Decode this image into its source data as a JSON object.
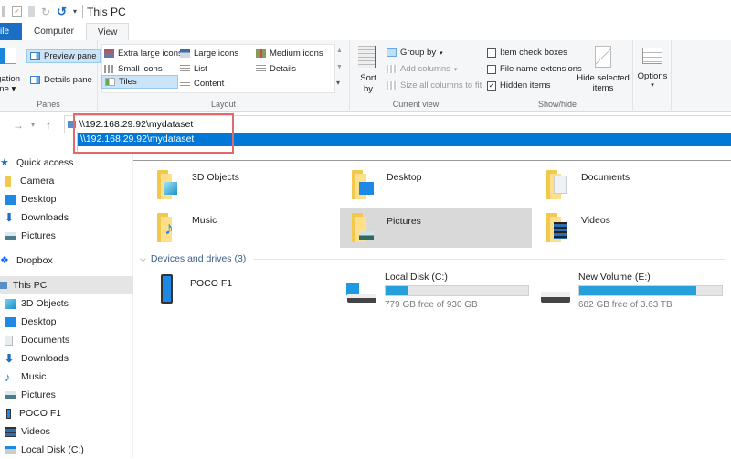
{
  "window": {
    "title": "This PC"
  },
  "tabs": [
    {
      "label": "File"
    },
    {
      "label": "Computer"
    },
    {
      "label": "View"
    }
  ],
  "ribbon": {
    "panes": {
      "label": "Panes",
      "navigation_pane": "Navigation pane",
      "preview_pane": "Preview pane",
      "details_pane": "Details pane"
    },
    "layout": {
      "label": "Layout",
      "items": [
        {
          "label": "Extra large icons"
        },
        {
          "label": "Large icons"
        },
        {
          "label": "Medium icons"
        },
        {
          "label": "Small icons"
        },
        {
          "label": "List"
        },
        {
          "label": "Details"
        },
        {
          "label": "Tiles",
          "selected": true
        },
        {
          "label": "Content"
        }
      ]
    },
    "current_view": {
      "label": "Current view",
      "sort_by": "Sort by",
      "group_by": "Group by",
      "add_columns": "Add columns",
      "size_columns": "Size all columns to fit"
    },
    "show_hide": {
      "label": "Show/hide",
      "item_check_boxes": {
        "label": "Item check boxes",
        "checked": false
      },
      "file_name_extensions": {
        "label": "File name extensions",
        "checked": false
      },
      "hidden_items": {
        "label": "Hidden items",
        "checked": true
      },
      "hide_selected": "Hide selected items"
    },
    "options": {
      "label": "Options"
    }
  },
  "address": {
    "value": "\\\\192.168.29.92\\mydataset",
    "suggestion": "\\\\192.168.29.92\\mydataset"
  },
  "sidebar": {
    "items": [
      {
        "label": "Quick access",
        "icon": "star-icon"
      },
      {
        "label": "Camera",
        "icon": "folder-icon"
      },
      {
        "label": "Desktop",
        "icon": "desktop-icon"
      },
      {
        "label": "Downloads",
        "icon": "download-icon"
      },
      {
        "label": "Pictures",
        "icon": "pictures-icon"
      },
      {
        "label": "Dropbox",
        "icon": "dropbox-icon"
      },
      {
        "label": "This PC",
        "icon": "computer-icon",
        "selected": true
      },
      {
        "label": "3D Objects",
        "icon": "cube-icon"
      },
      {
        "label": "Desktop",
        "icon": "desktop-icon"
      },
      {
        "label": "Documents",
        "icon": "document-icon"
      },
      {
        "label": "Downloads",
        "icon": "download-icon"
      },
      {
        "label": "Music",
        "icon": "music-icon"
      },
      {
        "label": "Pictures",
        "icon": "pictures-icon"
      },
      {
        "label": "POCO F1",
        "icon": "phone-icon"
      },
      {
        "label": "Videos",
        "icon": "video-icon"
      },
      {
        "label": "Local Disk (C:)",
        "icon": "drive-icon"
      }
    ]
  },
  "folders": [
    {
      "label": "3D Objects",
      "icon": "cube-icon"
    },
    {
      "label": "Desktop",
      "icon": "desktop-icon"
    },
    {
      "label": "Documents",
      "icon": "document-icon"
    },
    {
      "label": "Music",
      "icon": "music-icon"
    },
    {
      "label": "Pictures",
      "icon": "pictures-icon",
      "selected": true
    },
    {
      "label": "Videos",
      "icon": "video-icon"
    }
  ],
  "devices": {
    "header": "Devices and drives (3)",
    "items": [
      {
        "label": "POCO F1",
        "type": "phone"
      },
      {
        "label": "Local Disk (C:)",
        "free_text": "779 GB free of 930 GB",
        "used_fraction": 0.16
      },
      {
        "label": "New Volume (E:)",
        "free_text": "682 GB free of 3.63 TB",
        "used_fraction": 0.82
      }
    ]
  },
  "colors": {
    "accent": "#0078d7",
    "file_tab": "#1a6fc4",
    "drive_fill": "#26a0da",
    "highlight_box": "#e06a6a"
  }
}
